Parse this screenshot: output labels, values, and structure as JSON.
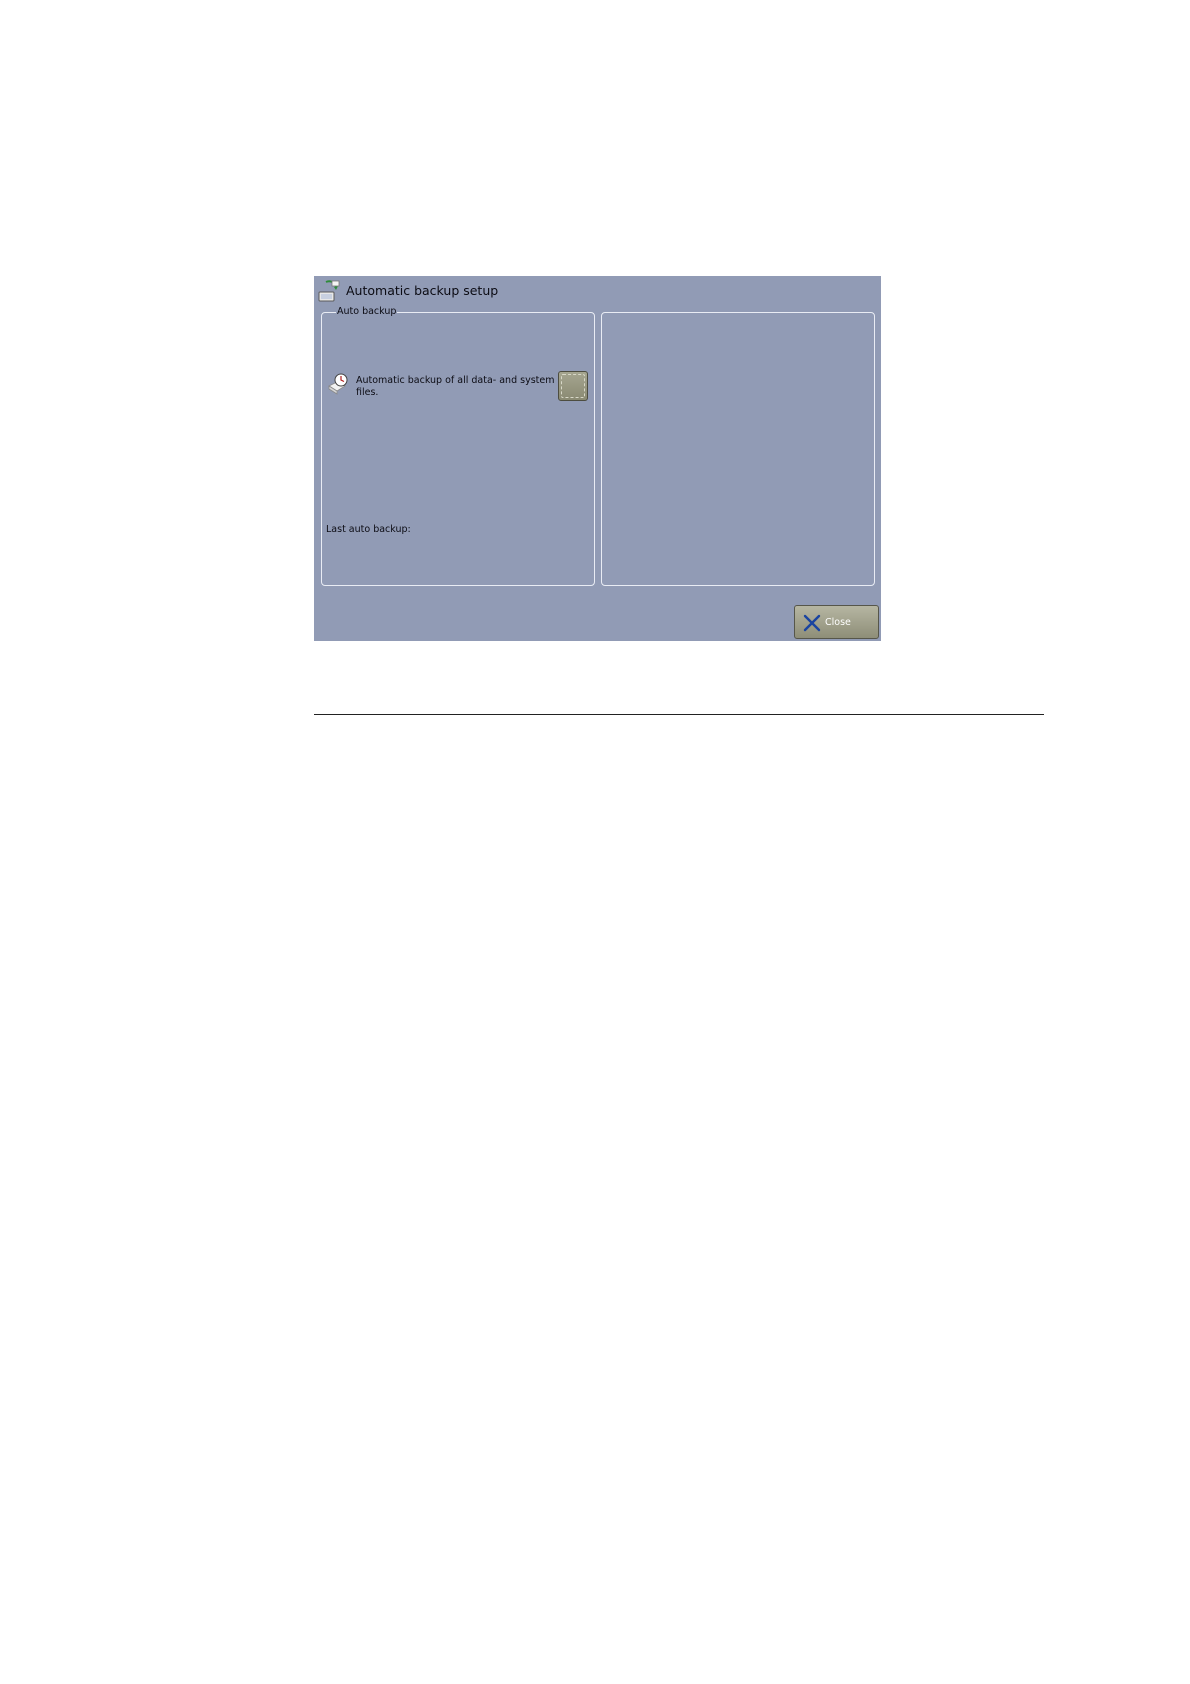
{
  "window": {
    "title": "Automatic backup setup",
    "title_icon": "backup-setup-icon"
  },
  "auto_backup_panel": {
    "legend": "Auto backup",
    "option_icon": "clock-backup-icon",
    "option_label": "Automatic backup of all data- and system files.",
    "toggle_checked": false,
    "last_backup_label": "Last auto backup:"
  },
  "footer": {
    "close_label": "Close",
    "close_icon": "close-icon"
  },
  "colors": {
    "screen_background": "#919bb5",
    "panel_border": "#e9ecf4",
    "button_face": "#9e9e88",
    "close_x": "#1a44a0"
  }
}
